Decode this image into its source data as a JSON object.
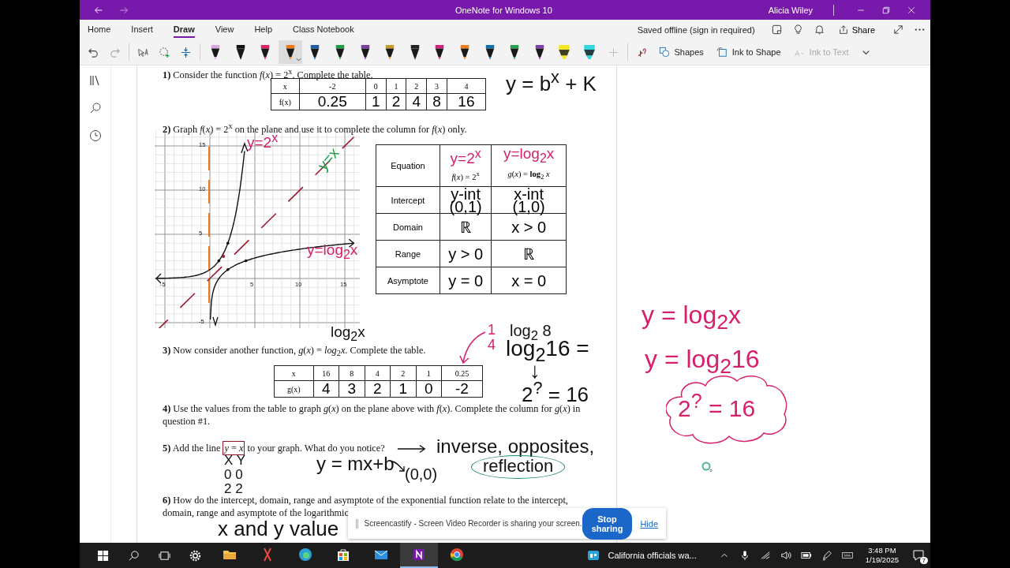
{
  "window": {
    "title": "OneNote for Windows 10",
    "user": "Alicia Wiley"
  },
  "tabs": [
    {
      "label": "Home",
      "selected": false
    },
    {
      "label": "Insert",
      "selected": false
    },
    {
      "label": "Draw",
      "selected": true
    },
    {
      "label": "View",
      "selected": false
    },
    {
      "label": "Help",
      "selected": false
    },
    {
      "label": "Class Notebook",
      "selected": false
    }
  ],
  "sync_status": "Saved offline (sign in required)",
  "share_label": "Share",
  "pens": [
    {
      "kind": "pen",
      "color": "#d8a6e0",
      "selected": false
    },
    {
      "kind": "pen",
      "color": "#111111",
      "selected": false
    },
    {
      "kind": "pen",
      "color": "#e0245e",
      "selected": false
    },
    {
      "kind": "pen",
      "color": "#f07c12",
      "selected": true
    },
    {
      "kind": "pen",
      "color": "#1f5fa8",
      "selected": false
    },
    {
      "kind": "pen",
      "color": "#1e9c4a",
      "selected": false
    },
    {
      "kind": "pen",
      "color": "#7a3fa0",
      "selected": false
    },
    {
      "kind": "pen",
      "color": "#c89a30",
      "selected": false
    },
    {
      "kind": "pen",
      "color": "#222222",
      "selected": false
    },
    {
      "kind": "pen",
      "color": "#d6207e",
      "selected": false
    },
    {
      "kind": "pen",
      "color": "#f08020",
      "selected": false
    },
    {
      "kind": "pen",
      "color": "#1570b0",
      "selected": false
    },
    {
      "kind": "pen",
      "color": "#26a050",
      "selected": false
    },
    {
      "kind": "pen",
      "color": "#8040b0",
      "selected": false
    },
    {
      "kind": "highlighter",
      "color": "#f5e626",
      "selected": false
    },
    {
      "kind": "highlighter",
      "color": "#36d6e0",
      "selected": false
    }
  ],
  "tools": [
    {
      "label": "Shapes",
      "disabled": false
    },
    {
      "label": "Ink to Shape",
      "disabled": false
    },
    {
      "label": "Ink to Text",
      "disabled": true
    }
  ],
  "worksheet": {
    "questions": [
      {
        "text": "**1)** Consider the function *f*(*x*) = 2$^{x}$. Complete the table."
      },
      {
        "text": "**2)** Graph *f*(*x*) = 2$^{x}$ on the plane and use it to complete the column for *f*(*x*) only."
      },
      {
        "text": "**3)** Now consider another function, *g*(*x*) = *log*$_{2}$*x*. Complete the table."
      },
      {
        "text": "**4)** Use the values from the table to graph *g*(*x*) on the plane above with *f*(*x*). Complete the column for *g*(*x*) in\nquestion #1."
      },
      {
        "text": "**5)** Add the line",
        "boxed": "*y* = *x*",
        "rest": "to your graph. What do you notice?"
      },
      {
        "text": "**6)** How do the intercept, domain, range and asymptote of the exponential function relate to the intercept,\ndomain, range and asymptote of the logarithmic"
      }
    ],
    "table_1": [
      [
        "x",
        "-2",
        "0",
        "1",
        "2",
        "3",
        "4"
      ],
      [
        "f(x)",
        "0.25",
        "1",
        "2",
        "4",
        "8",
        "16"
      ]
    ],
    "graph": {
      "x_ticks": [
        "-5",
        "5",
        "10",
        "15"
      ],
      "y_ticks": [
        "15",
        "10",
        "5",
        "-5"
      ]
    },
    "summary_table": {
      "header": {
        "label": "Equation",
        "printed": [
          "*f*(*x*) = 2$^{x}$",
          "*g*(*x*) = **log**$_{2}$ *x*"
        ],
        "ink": [
          "y=2$^{x}$",
          "y=log$_{2}$x"
        ]
      },
      "rows": [
        {
          "label": "Intercept",
          "values": [
            "y-int\n(0,1)",
            "x-int\n(1,0)"
          ]
        },
        {
          "label": "Domain",
          "values": [
            "ℝ",
            "x > 0"
          ]
        },
        {
          "label": "Range",
          "values": [
            "y > 0",
            "ℝ"
          ]
        },
        {
          "label": "Asymptote",
          "values": [
            "y = 0",
            "x = 0"
          ]
        }
      ]
    },
    "table_3": [
      [
        "x",
        "16",
        "8",
        "4",
        "2",
        "1",
        "0.25"
      ],
      [
        "g(x)",
        "4",
        "3",
        "2",
        "1",
        "0",
        "-2"
      ]
    ],
    "ink": [
      {
        "text": "y = b$^{x}$ + K",
        "color": "#111111"
      },
      {
        "text": "y=2$^{x}$",
        "color": "#d6206e"
      },
      {
        "text": "y=x",
        "color": "#1e9c4a"
      },
      {
        "text": "y=log$_{2}$x",
        "color": "#d6206e"
      },
      {
        "text": "log$_{2}$x",
        "color": "#111111"
      },
      {
        "text": "1\n4",
        "color": "#d6206e"
      },
      {
        "text": "log$_{2}$ 8",
        "color": "#111111"
      },
      {
        "text": "log$_{2}$16 =",
        "color": "#111111"
      },
      {
        "text": "↓",
        "color": "#111111"
      },
      {
        "text": "2$^{?}$ = 16",
        "color": "#111111"
      },
      {
        "text": "X Y\n0 0\n2 2",
        "color": "#111111"
      },
      {
        "text": "y = mx+b",
        "color": "#111111"
      },
      {
        "text": "(0,0)",
        "color": "#111111"
      },
      {
        "text": "inverse, opposites,",
        "color": "#111111"
      },
      {
        "text": "reflection",
        "color": "#111111"
      },
      {
        "text": "x and y value",
        "color": "#111111"
      },
      {
        "text": "y = log$_{2}$x",
        "color": "#d6206e"
      },
      {
        "text": "y = log$_{2}$16",
        "color": "#d6206e"
      },
      {
        "text": "2$^{?}$ = 16",
        "color": "#d6206e"
      }
    ]
  },
  "notification": {
    "text": "Screencastify - Screen Video Recorder is sharing your screen.",
    "button": "Stop sharing",
    "link": "Hide"
  },
  "taskbar": {
    "apps": [
      {
        "selected": false
      },
      {
        "selected": false
      },
      {
        "selected": false
      },
      {
        "selected": false
      },
      {
        "selected": false
      },
      {
        "selected": true
      },
      {
        "selected": false
      }
    ],
    "news": "California officials wa...",
    "time": "3:48 PM",
    "date": "1/19/2025",
    "notifications": "7"
  }
}
